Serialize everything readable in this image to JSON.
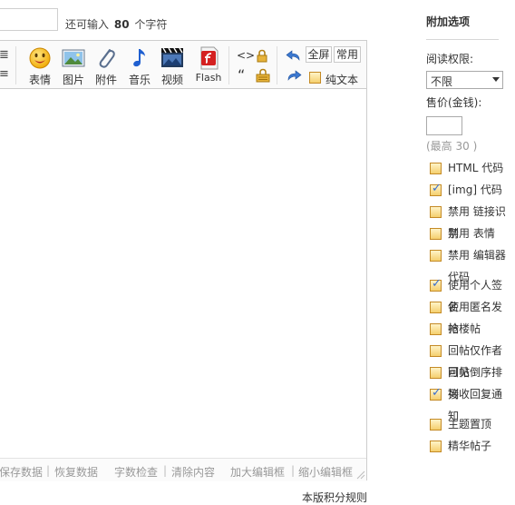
{
  "title_bar": {
    "remaining_prefix": "还可输入",
    "remaining_count": "80",
    "remaining_suffix": "个字符"
  },
  "toolbar": {
    "left_partial_top": "≣",
    "left_partial_bottom": "≡",
    "buttons": [
      {
        "label": "表情",
        "icon": "smiley-icon"
      },
      {
        "label": "图片",
        "icon": "image-icon"
      },
      {
        "label": "附件",
        "icon": "paperclip-icon"
      },
      {
        "label": "音乐",
        "icon": "music-note-icon"
      },
      {
        "label": "视频",
        "icon": "video-icon"
      },
      {
        "label": "Flash",
        "icon": "flash-icon"
      }
    ],
    "code_glyph": "<>",
    "quote_glyph": "“",
    "fullscreen": "全屏",
    "common": "常用",
    "plaintext": "纯文本"
  },
  "statusbar": {
    "save_data": "保存数据",
    "restore_data": "恢复数据",
    "word_check": "字数检查",
    "clear_content": "清除内容",
    "enlarge": "加大编辑框",
    "shrink": "缩小编辑框"
  },
  "rules_link": "本版积分规则",
  "panel": {
    "title": "附加选项",
    "read_perm_label": "阅读权限:",
    "read_perm_value": "不限",
    "price_label": "售价(金钱):",
    "price_value": "",
    "price_hint": "(最高 30 )",
    "options": [
      {
        "label": "HTML 代码",
        "checked": false
      },
      {
        "label": "[img] 代码",
        "checked": true
      },
      {
        "label": "禁用 链接识别",
        "checked": false
      },
      {
        "label": "禁用 表情",
        "checked": false
      },
      {
        "label": "禁用 编辑器代码",
        "checked": false
      },
      {
        "label": "使用个人签名",
        "checked": true
      },
      {
        "label": "使用匿名发帖",
        "checked": false
      },
      {
        "label": "抢楼帖",
        "checked": false
      },
      {
        "label": "回帖仅作者可见",
        "checked": false
      },
      {
        "label": "回帖倒序排列",
        "checked": false
      },
      {
        "label": "接收回复通知",
        "checked": true
      },
      {
        "label": "主题置顶",
        "checked": false
      },
      {
        "label": "精华帖子",
        "checked": false
      }
    ]
  },
  "colors": {
    "accent_blue": "#3a6fcf",
    "checkbox_fill": "#f5cf6e",
    "border": "#cdcdcd",
    "muted": "#999999"
  }
}
